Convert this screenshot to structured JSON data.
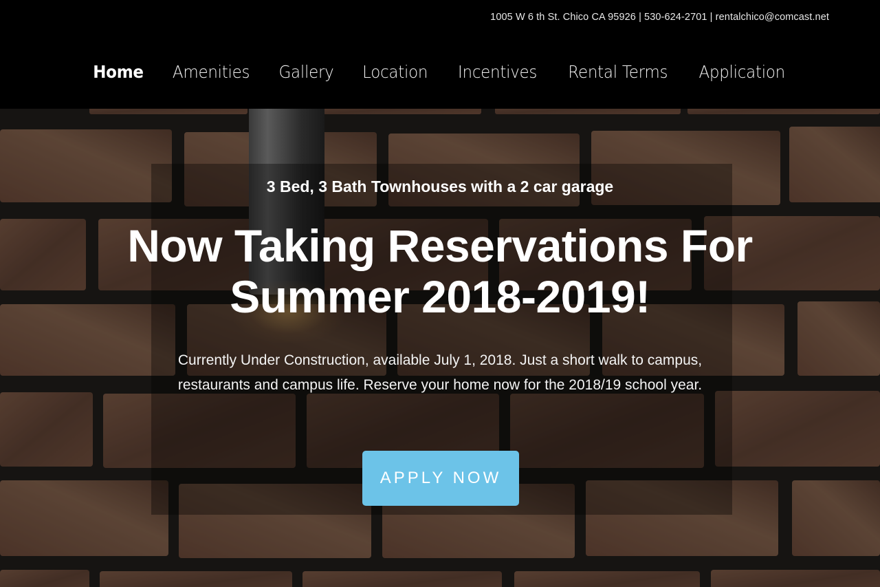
{
  "header": {
    "contact": "1005 W 6 th St. Chico CA 95926 | 530-624-2701 | rentalchico@comcast.net"
  },
  "nav": {
    "items": [
      {
        "label": "Home",
        "active": true
      },
      {
        "label": "Amenities"
      },
      {
        "label": "Gallery"
      },
      {
        "label": "Location"
      },
      {
        "label": "Incentives"
      },
      {
        "label": "Rental Terms"
      },
      {
        "label": "Application"
      }
    ]
  },
  "hero": {
    "tagline": "3 Bed, 3 Bath Townhouses with a 2 car garage",
    "headline_line1": "Now Taking Reservations For",
    "headline_line2": "Summer 2018-2019!",
    "description_line1": "Currently Under Construction, available July 1, 2018. Just a short walk to campus,",
    "description_line2": "restaurants and campus life. Reserve your home now for the 2018/19 school year.",
    "cta_label": "APPLY NOW"
  },
  "colors": {
    "header_bg": "#000000",
    "cta_bg": "#6cc3e8",
    "brick": "#6b4a3a",
    "mortar": "#1c1a18"
  }
}
